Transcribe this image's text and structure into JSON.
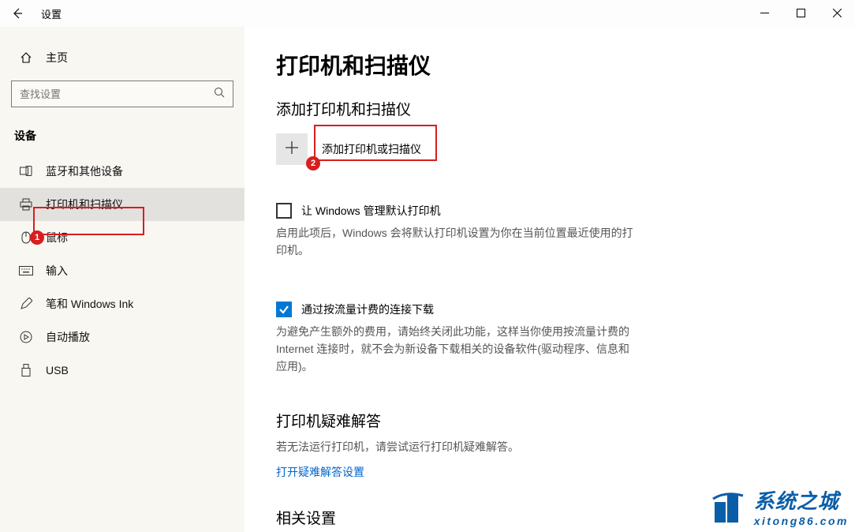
{
  "window": {
    "title": "设置",
    "controls": {
      "minimize": "—",
      "maximize": "☐",
      "close": "✕"
    }
  },
  "sidebar": {
    "home_label": "主页",
    "search_placeholder": "查找设置",
    "section_title": "设备",
    "items": [
      {
        "label": "蓝牙和其他设备"
      },
      {
        "label": "打印机和扫描仪"
      },
      {
        "label": "鼠标"
      },
      {
        "label": "输入"
      },
      {
        "label": "笔和 Windows Ink"
      },
      {
        "label": "自动播放"
      },
      {
        "label": "USB"
      }
    ]
  },
  "main": {
    "page_title": "打印机和扫描仪",
    "add_section_heading": "添加打印机和扫描仪",
    "add_button_label": "添加打印机或扫描仪",
    "manage_default": {
      "checkbox_label": "让 Windows 管理默认打印机",
      "desc": "启用此项后，Windows 会将默认打印机设置为你在当前位置最近使用的打印机。"
    },
    "metered": {
      "checkbox_label": "通过按流量计费的连接下载",
      "desc": "为避免产生额外的费用，请始终关闭此功能，这样当你使用按流量计费的 Internet 连接时，就不会为新设备下载相关的设备软件(驱动程序、信息和应用)。"
    },
    "troubleshoot": {
      "heading": "打印机疑难解答",
      "desc": "若无法运行打印机，请尝试运行打印机疑难解答。",
      "link": "打开疑难解答设置"
    },
    "related_heading": "相关设置"
  },
  "annotations": {
    "badge1": "1",
    "badge2": "2"
  },
  "watermark": {
    "title": "系统之城",
    "url": "xitong86.com"
  }
}
